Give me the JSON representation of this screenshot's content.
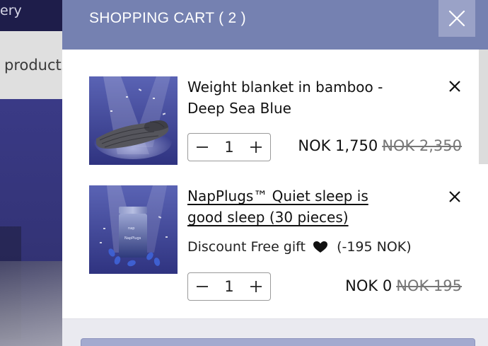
{
  "background": {
    "nav_text": "ery",
    "menu_text": "products"
  },
  "cart": {
    "title": "SHOPPING CART ( 2 )",
    "items": [
      {
        "title": "Weight blanket in bamboo - Deep Sea Blue",
        "quantity": "1",
        "price": "NOK 1,750",
        "old_price": "NOK 2,350"
      },
      {
        "title": "NapPlugs™ Quiet sleep is good sleep (30 pieces)",
        "discount_label": "Discount Free gift",
        "discount_amount": "(-195 NOK)",
        "quantity": "1",
        "price": "NOK 0",
        "old_price": "NOK 195",
        "product_logo": "nap",
        "product_label": "NapPlugs"
      }
    ]
  },
  "colors": {
    "header": "#7581b1",
    "close_button": "#9aa2c7",
    "navy": "#1e1d4a"
  }
}
